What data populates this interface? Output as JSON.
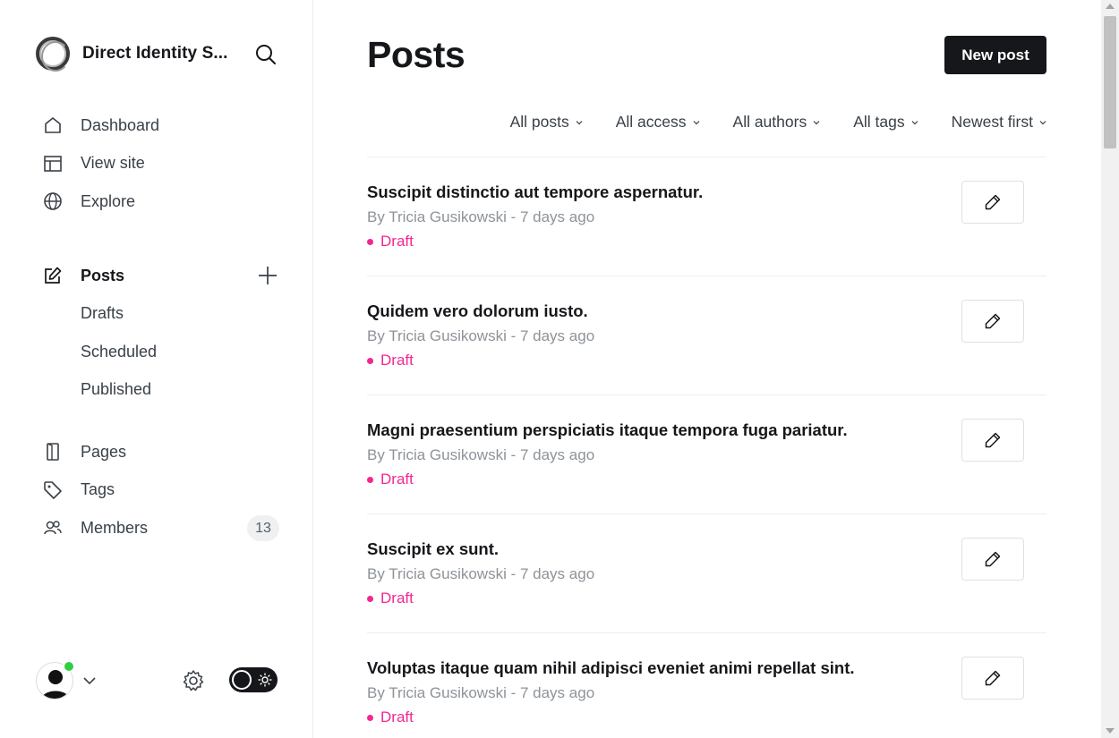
{
  "brand": {
    "name": "Direct Identity S...",
    "logo_icon": "circle-logo",
    "search_icon": "search-icon"
  },
  "nav": {
    "primary": [
      {
        "label": "Dashboard",
        "icon": "home-icon"
      },
      {
        "label": "View site",
        "icon": "layout-icon"
      },
      {
        "label": "Explore",
        "icon": "globe-icon"
      }
    ],
    "posts": {
      "label": "Posts",
      "icon": "edit-icon",
      "add_icon": "plus-icon"
    },
    "posts_sub": [
      {
        "label": "Drafts"
      },
      {
        "label": "Scheduled"
      },
      {
        "label": "Published"
      }
    ],
    "secondary": [
      {
        "label": "Pages",
        "icon": "page-icon"
      },
      {
        "label": "Tags",
        "icon": "tag-icon"
      },
      {
        "label": "Members",
        "icon": "members-icon",
        "count": "13"
      }
    ]
  },
  "footer": {
    "avatar_icon": "user-avatar",
    "online_color": "#30cf43",
    "settings_icon": "gear-icon",
    "theme_toggle_icon": "sun-icon"
  },
  "main": {
    "title": "Posts",
    "new_post_label": "New post",
    "filters": [
      {
        "label": "All posts"
      },
      {
        "label": "All access"
      },
      {
        "label": "All authors"
      },
      {
        "label": "All tags"
      },
      {
        "label": "Newest first"
      }
    ],
    "posts": [
      {
        "title": "Suscipit distinctio aut tempore aspernatur.",
        "meta": "By Tricia Gusikowski - 7 days ago",
        "status": "Draft"
      },
      {
        "title": "Quidem vero dolorum iusto.",
        "meta": "By Tricia Gusikowski - 7 days ago",
        "status": "Draft"
      },
      {
        "title": "Magni praesentium perspiciatis itaque tempora fuga pariatur.",
        "meta": "By Tricia Gusikowski - 7 days ago",
        "status": "Draft"
      },
      {
        "title": "Suscipit ex sunt.",
        "meta": "By Tricia Gusikowski - 7 days ago",
        "status": "Draft"
      },
      {
        "title": "Voluptas itaque quam nihil adipisci eveniet animi repellat sint.",
        "meta": "By Tricia Gusikowski - 7 days ago",
        "status": "Draft"
      }
    ]
  },
  "colors": {
    "accent": "#15171a",
    "draft": "#f42691",
    "muted": "#8e9399"
  }
}
